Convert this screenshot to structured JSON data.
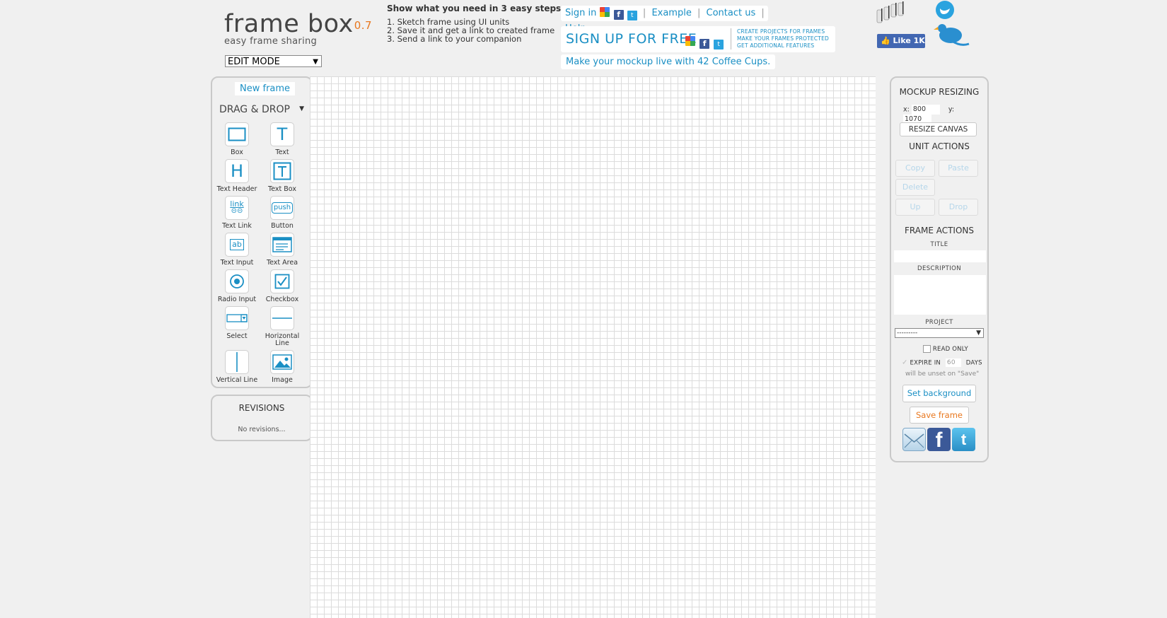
{
  "header": {
    "app_name": "frame box",
    "version": "0.7",
    "tagline": "easy frame sharing",
    "mode_select": "EDIT MODE",
    "steps_title": "Show what you need in 3 easy steps:",
    "steps": [
      "1. Sketch frame using UI units",
      "2. Save it and get a link to created frame",
      "3. Send a link to your companion"
    ],
    "nav": {
      "signin": "Sign in",
      "example": "Example",
      "contact": "Contact us",
      "help": "Help"
    },
    "signup": {
      "label": "SIGN UP FOR FREE",
      "features": [
        "CREATE PROJECTS FOR FRAMES",
        "MAKE YOUR FRAMES PROTECTED",
        "GET ADDITIONAL FEATURES"
      ]
    },
    "coffee_link": "Make your mockup live with 42 Coffee Cups.",
    "like_button": "Like 1K"
  },
  "left_panel": {
    "new_frame": "New frame",
    "drag_drop_title": "DRAG & DROP",
    "tools": [
      {
        "name": "box",
        "label": "Box"
      },
      {
        "name": "text",
        "label": "Text"
      },
      {
        "name": "text-header",
        "label": "Text Header"
      },
      {
        "name": "text-box",
        "label": "Text Box"
      },
      {
        "name": "text-link",
        "label": "Text Link"
      },
      {
        "name": "button",
        "label": "Button"
      },
      {
        "name": "text-input",
        "label": "Text Input"
      },
      {
        "name": "text-area",
        "label": "Text Area"
      },
      {
        "name": "radio-input",
        "label": "Radio Input"
      },
      {
        "name": "checkbox",
        "label": "Checkbox"
      },
      {
        "name": "select",
        "label": "Select"
      },
      {
        "name": "horizontal-line",
        "label": "Horizontal Line"
      },
      {
        "name": "vertical-line",
        "label": "Vertical Line"
      },
      {
        "name": "image",
        "label": "Image"
      }
    ],
    "icon_text": {
      "text": "T",
      "header": "H",
      "link": "link",
      "push": "push",
      "input": "ab"
    }
  },
  "revisions": {
    "title": "REVISIONS",
    "empty": "No revisions..."
  },
  "right_panel": {
    "mockup_resizing": "MOCKUP RESIZING",
    "x_label": "x:",
    "x_value": "800",
    "y_label": "y:",
    "y_value": "1070",
    "resize_button": "RESIZE CANVAS",
    "unit_actions": "UNIT ACTIONS",
    "copy": "Copy",
    "paste": "Paste",
    "delete": "Delete",
    "up": "Up",
    "drop": "Drop",
    "frame_actions": "FRAME ACTIONS",
    "title_label": "TITLE",
    "description_label": "DESCRIPTION",
    "project_label": "PROJECT",
    "project_value": "---------",
    "read_only": "READ ONLY",
    "expire_in": "EXPIRE IN",
    "expire_days": "60",
    "days": "DAYS",
    "expire_note": "will be unset on \"Save\"",
    "set_background": "Set background",
    "save_frame": "Save frame",
    "share_icons": [
      "mail-icon",
      "facebook-icon",
      "twitter-icon"
    ]
  },
  "colors": {
    "accent_blue": "#1a8fc4",
    "accent_orange": "#e8771e",
    "page_bg": "#f0f0f0",
    "panel_border": "#c9c9c9"
  }
}
